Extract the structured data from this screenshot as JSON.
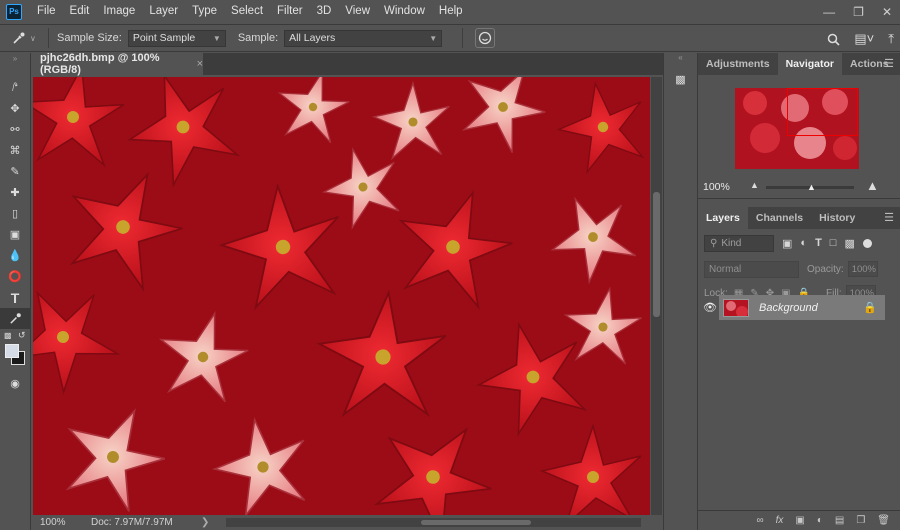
{
  "menubar": {
    "app_logo": "Ps",
    "items": [
      "File",
      "Edit",
      "Image",
      "Layer",
      "Type",
      "Select",
      "Filter",
      "3D",
      "View",
      "Window",
      "Help"
    ]
  },
  "options": {
    "sample_size_label": "Sample Size:",
    "sample_size_value": "Point Sample",
    "sample_label": "Sample:",
    "sample_value": "All Layers"
  },
  "document": {
    "tab_title": "pjhc26dh.bmp @ 100% (RGB/8)",
    "tab_close": "×",
    "zoom": "100%",
    "doc_size": "Doc: 7.97M/7.97M"
  },
  "panels_top": {
    "tabs": [
      "Adjustments",
      "Navigator",
      "Actions"
    ],
    "active": "Navigator",
    "zoom_value": "100%"
  },
  "layers_panel": {
    "tabs": [
      "Layers",
      "Channels",
      "History"
    ],
    "active": "Layers",
    "kind_placeholder": "Kind",
    "blend_mode": "Normal",
    "opacity_label": "Opacity:",
    "opacity_value": "100%",
    "lock_label": "Lock:",
    "fill_label": "Fill:",
    "fill_value": "100%",
    "layers": [
      {
        "name": "Background",
        "locked": true,
        "visible": true
      }
    ]
  },
  "colors": {
    "accent": "#31a8ff",
    "bg": "#535353",
    "canvas_red": "#c8101e"
  }
}
